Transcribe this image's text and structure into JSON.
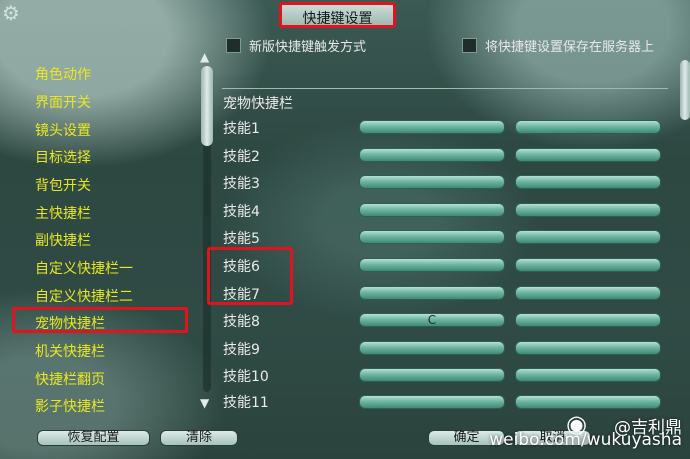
{
  "window": {
    "title": "快捷键设置"
  },
  "options": {
    "new_trigger_label": "新版快捷键触发方式",
    "save_server_label": "将快捷键设置保存在服务器上"
  },
  "sidebar": {
    "items": [
      {
        "label": "角色动作"
      },
      {
        "label": "界面开关"
      },
      {
        "label": "镜头设置"
      },
      {
        "label": "目标选择"
      },
      {
        "label": "背包开关"
      },
      {
        "label": "主快捷栏"
      },
      {
        "label": "副快捷栏"
      },
      {
        "label": "自定义快捷栏一"
      },
      {
        "label": "自定义快捷栏二"
      },
      {
        "label": "宠物快捷栏"
      },
      {
        "label": "机关快捷栏"
      },
      {
        "label": "快捷栏翻页"
      },
      {
        "label": "影子快捷栏"
      }
    ],
    "selected": "宠物快捷栏"
  },
  "main": {
    "group_title": "宠物快捷栏",
    "rows": [
      {
        "label": "技能1",
        "key1": "",
        "key2": ""
      },
      {
        "label": "技能2",
        "key1": "",
        "key2": ""
      },
      {
        "label": "技能3",
        "key1": "",
        "key2": ""
      },
      {
        "label": "技能4",
        "key1": "",
        "key2": ""
      },
      {
        "label": "技能5",
        "key1": "",
        "key2": ""
      },
      {
        "label": "技能6",
        "key1": "",
        "key2": ""
      },
      {
        "label": "技能7",
        "key1": "",
        "key2": ""
      },
      {
        "label": "技能8",
        "key1": "C",
        "key2": ""
      },
      {
        "label": "技能9",
        "key1": "",
        "key2": ""
      },
      {
        "label": "技能10",
        "key1": "",
        "key2": ""
      },
      {
        "label": "技能11",
        "key1": "",
        "key2": ""
      }
    ]
  },
  "buttons": {
    "restore": "恢复配置",
    "clear": "清除",
    "confirm": "确定",
    "cancel": "取消"
  },
  "watermark": {
    "line1": "@吉利鼎",
    "line2": "weibo.com/wukuyasha"
  }
}
